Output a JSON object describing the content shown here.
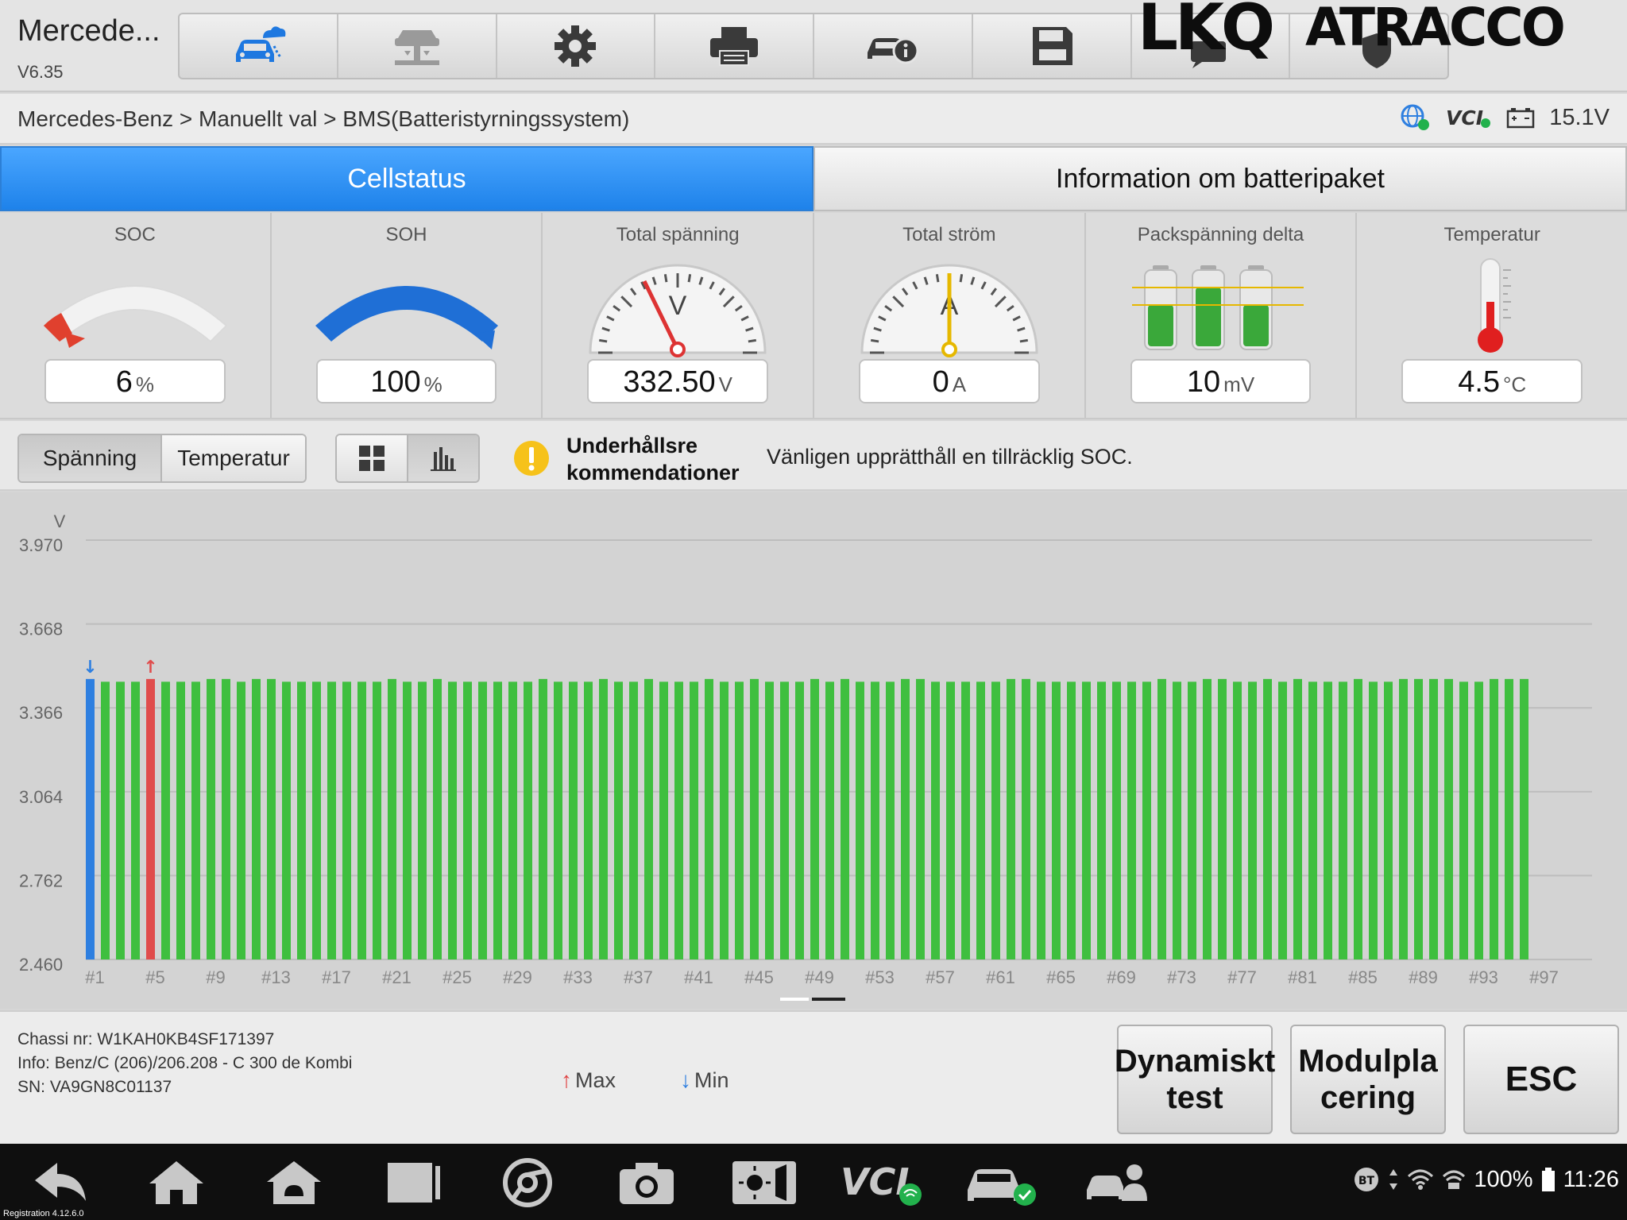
{
  "app": {
    "title": "Mercede...",
    "version": "V6.35"
  },
  "brand": {
    "lkq": "LKQ",
    "atracco": "ATRACCO"
  },
  "toolbar": {
    "items": [
      "car-cloud-icon",
      "lift-icon",
      "gear-icon",
      "printer-icon",
      "car-info-icon",
      "save-icon",
      "chat-icon",
      "shield-icon"
    ]
  },
  "breadcrumb": "Mercedes-Benz > Manuellt val > BMS(Batteristyrningssystem)",
  "status": {
    "vci": "VCI",
    "battery_voltage": "15.1V"
  },
  "tabs": [
    {
      "label": "Cellstatus",
      "active": true
    },
    {
      "label": "Information om batteripaket",
      "active": false
    }
  ],
  "metrics": {
    "soc": {
      "label": "SOC",
      "value": "6",
      "unit": "%"
    },
    "soh": {
      "label": "SOH",
      "value": "100",
      "unit": "%"
    },
    "total_voltage": {
      "label": "Total spänning",
      "value": "332.50",
      "unit": "V",
      "gauge_letter": "V"
    },
    "total_current": {
      "label": "Total ström",
      "value": "0",
      "unit": "A",
      "gauge_letter": "A"
    },
    "pack_delta": {
      "label": "Packspänning delta",
      "value": "10",
      "unit": "mV"
    },
    "temperature": {
      "label": "Temperatur",
      "value": "4.5",
      "unit": "°C"
    }
  },
  "controls": {
    "mode_buttons": [
      "Spänning",
      "Temperatur"
    ],
    "mode_selected": "Spänning",
    "view_buttons": [
      "grid-view-icon",
      "bar-chart-icon"
    ],
    "view_selected": "bar-chart-icon"
  },
  "maintenance": {
    "title": "Underhållsre kommendationer",
    "text": "Vänligen upprätthåll en tillräcklig SOC."
  },
  "chart_data": {
    "type": "bar",
    "ylabel": "V",
    "ylim": [
      2.46,
      3.97
    ],
    "yticks": [
      "3.970",
      "3.668",
      "3.366",
      "3.064",
      "2.762",
      "2.460"
    ],
    "xtick_labels": [
      "#1",
      "#5",
      "#9",
      "#13",
      "#17",
      "#21",
      "#25",
      "#29",
      "#33",
      "#37",
      "#41",
      "#45",
      "#49",
      "#53",
      "#57",
      "#61",
      "#65",
      "#69",
      "#73",
      "#77",
      "#81",
      "#85",
      "#89",
      "#93",
      "#97"
    ],
    "cell_count": 96,
    "values": [
      3.47,
      3.46,
      3.46,
      3.46,
      3.47,
      3.46,
      3.46,
      3.46,
      3.47,
      3.47,
      3.46,
      3.47,
      3.47,
      3.46,
      3.46,
      3.46,
      3.46,
      3.46,
      3.46,
      3.46,
      3.47,
      3.46,
      3.46,
      3.47,
      3.46,
      3.46,
      3.46,
      3.46,
      3.46,
      3.46,
      3.47,
      3.46,
      3.46,
      3.46,
      3.47,
      3.46,
      3.46,
      3.47,
      3.46,
      3.46,
      3.46,
      3.47,
      3.46,
      3.46,
      3.47,
      3.46,
      3.46,
      3.46,
      3.47,
      3.46,
      3.47,
      3.46,
      3.46,
      3.46,
      3.47,
      3.47,
      3.46,
      3.46,
      3.46,
      3.46,
      3.46,
      3.47,
      3.47,
      3.46,
      3.46,
      3.46,
      3.46,
      3.46,
      3.46,
      3.46,
      3.46,
      3.47,
      3.46,
      3.46,
      3.47,
      3.47,
      3.46,
      3.46,
      3.47,
      3.46,
      3.47,
      3.46,
      3.46,
      3.46,
      3.47,
      3.46,
      3.46,
      3.47,
      3.47,
      3.47,
      3.47,
      3.46,
      3.46,
      3.47,
      3.47,
      3.47
    ],
    "min_index": 1,
    "max_index": 5,
    "colors": {
      "bar": "#3fbf3f",
      "min": "#2e7fe0",
      "max": "#e04c4c",
      "grid": "#bdbdbd"
    }
  },
  "footer": {
    "info": [
      "Chassi nr: W1KAH0KB4SF171397",
      "Info: Benz/C (206)/206.208 - C 300 de Kombi",
      "SN: VA9GN8C01137"
    ],
    "legend_max": "Max",
    "legend_min": "Min",
    "buttons": {
      "dynamic": "Dynamiskt test",
      "module": "Modulpla cering",
      "esc": "ESC"
    }
  },
  "system_bar": {
    "battery": "100%",
    "time": "11:26",
    "registration": "Registration 4.12.6.0",
    "bt": "BT"
  }
}
